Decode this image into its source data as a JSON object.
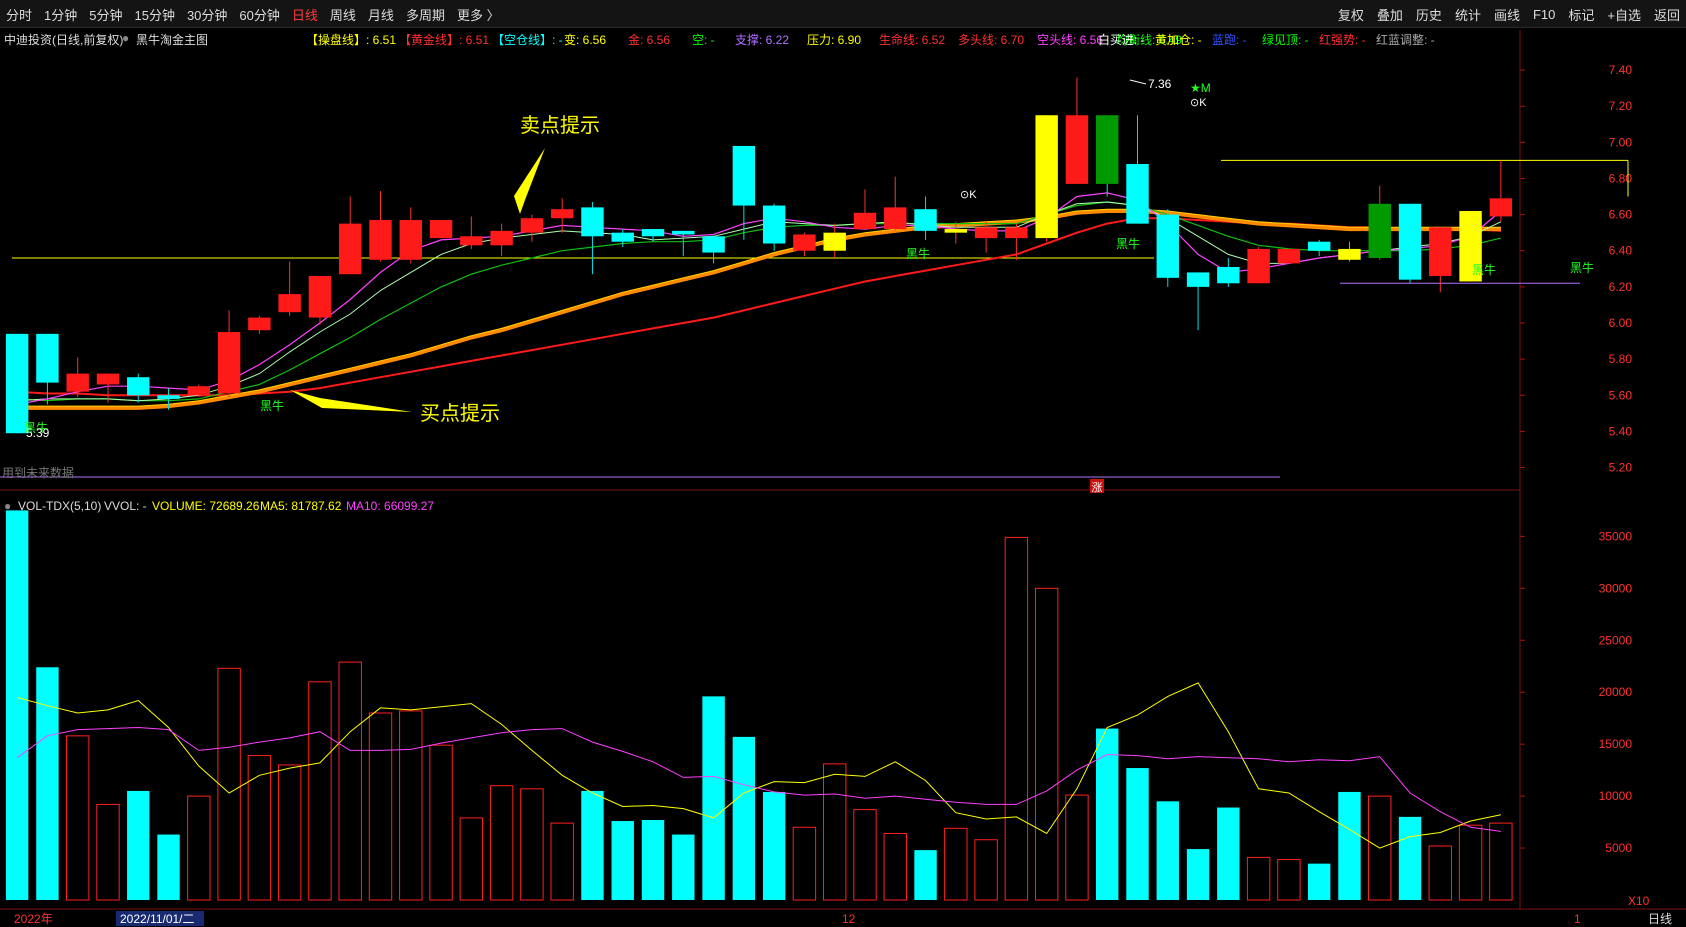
{
  "toolbar": {
    "periods": [
      "分时",
      "1分钟",
      "5分钟",
      "15分钟",
      "30分钟",
      "60分钟",
      "日线",
      "周线",
      "月线",
      "多周期",
      "更多 〉"
    ],
    "active_period": "日线",
    "right": [
      "复权",
      "叠加",
      "历史",
      "统计",
      "画线",
      "F10",
      "标记",
      "+自选",
      "返回"
    ]
  },
  "header": {
    "stock": "中迪投资(日线,前复权)",
    "formula": "黑牛淘金主图",
    "items": [
      {
        "text": "【操盘线】: 6.51",
        "color": "#ffff00"
      },
      {
        "text": "【黄金线】: 6.51",
        "color": "#ff3030"
      },
      {
        "text": "【空仓线】: -",
        "color": "#00ffff"
      },
      {
        "text": "变: 6.56",
        "color": "#ffff00"
      },
      {
        "text": "金: 6.56",
        "color": "#ff3030"
      },
      {
        "text": "空: -",
        "color": "#00ff00"
      },
      {
        "text": "支撑: 6.22",
        "color": "#b070ff"
      },
      {
        "text": "压力: 6.90",
        "color": "#ffff00"
      },
      {
        "text": "生命线: 6.52",
        "color": "#ff3030"
      },
      {
        "text": "多头线: 6.70",
        "color": "#ff3030"
      },
      {
        "text": "空头线: 6.56",
        "color": "#ff40ff"
      },
      {
        "text": "均衡线: 6.49",
        "color": "#00ff00"
      },
      {
        "text": "白买进: -",
        "color": "#ffffff"
      },
      {
        "text": "黄加仓: -",
        "color": "#ffff00"
      },
      {
        "text": "蓝跑: -",
        "color": "#3050ff"
      },
      {
        "text": "绿见顶: -",
        "color": "#00ff00"
      },
      {
        "text": "红强势: -",
        "color": "#ff3030"
      },
      {
        "text": "红蓝调整: -",
        "color": "#aaaaaa"
      }
    ]
  },
  "annotations": {
    "sell": "卖点提示",
    "buy": "买点提示",
    "high": "7.36",
    "low": "5.39",
    "heiniu": "黑牛",
    "star_m": "★M",
    "ok": "⊙K",
    "no_future": "用到未来数据",
    "zhang": "涨"
  },
  "volume_header": {
    "name": "VOL-TDX(5,10)",
    "vvol": "VVOL: -",
    "volume": "VOLUME: 72689.26",
    "ma5": "MA5: 81787.62",
    "ma10": "MA10: 66099.27"
  },
  "axis_bottom": {
    "labels": [
      "2022年",
      "2022/11/01/二",
      "12",
      "1"
    ],
    "right": "日线",
    "x10": "X10"
  },
  "colors": {
    "up": "#ff2020",
    "down": "#00ffff",
    "yellow": "#ffff00",
    "green": "#00c000",
    "magenta": "#ff40ff",
    "bg": "#000000"
  },
  "chart_data": [
    {
      "type": "candlestick",
      "title": "中迪投资(日线,前复权)",
      "ylim": [
        5.12,
        7.5
      ],
      "y_ticks": [
        5.2,
        5.4,
        5.6,
        5.8,
        6.0,
        6.2,
        6.4,
        6.6,
        6.8,
        7.0,
        7.2,
        7.4
      ],
      "candles": [
        {
          "o": 5.94,
          "c": 5.39,
          "h": 5.94,
          "l": 5.39
        },
        {
          "o": 5.94,
          "c": 5.67,
          "h": 5.94,
          "l": 5.55
        },
        {
          "o": 5.62,
          "c": 5.72,
          "h": 5.81,
          "l": 5.59
        },
        {
          "o": 5.66,
          "c": 5.72,
          "h": 5.72,
          "l": 5.56
        },
        {
          "o": 5.7,
          "c": 5.6,
          "h": 5.72,
          "l": 5.56
        },
        {
          "o": 5.6,
          "c": 5.58,
          "h": 5.64,
          "l": 5.52
        },
        {
          "o": 5.6,
          "c": 5.65,
          "h": 5.66,
          "l": 5.59
        },
        {
          "o": 5.61,
          "c": 5.95,
          "h": 6.07,
          "l": 5.59
        },
        {
          "o": 5.96,
          "c": 6.03,
          "h": 6.04,
          "l": 5.94
        },
        {
          "o": 6.06,
          "c": 6.16,
          "h": 6.34,
          "l": 6.04
        },
        {
          "o": 6.03,
          "c": 6.26,
          "h": 6.26,
          "l": 5.99
        },
        {
          "o": 6.27,
          "c": 6.55,
          "h": 6.7,
          "l": 6.27
        },
        {
          "o": 6.35,
          "c": 6.57,
          "h": 6.73,
          "l": 6.34
        },
        {
          "o": 6.35,
          "c": 6.57,
          "h": 6.64,
          "l": 6.33
        },
        {
          "o": 6.47,
          "c": 6.57,
          "h": 6.57,
          "l": 6.47
        },
        {
          "o": 6.43,
          "c": 6.48,
          "h": 6.59,
          "l": 6.41
        },
        {
          "o": 6.43,
          "c": 6.51,
          "h": 6.55,
          "l": 6.37
        },
        {
          "o": 6.5,
          "c": 6.58,
          "h": 6.6,
          "l": 6.45
        },
        {
          "o": 6.58,
          "c": 6.63,
          "h": 6.69,
          "l": 6.5
        },
        {
          "o": 6.64,
          "c": 6.48,
          "h": 6.67,
          "l": 6.27
        },
        {
          "o": 6.5,
          "c": 6.45,
          "h": 6.52,
          "l": 6.42
        },
        {
          "o": 6.52,
          "c": 6.48,
          "h": 6.52,
          "l": 6.45
        },
        {
          "o": 6.51,
          "c": 6.49,
          "h": 6.51,
          "l": 6.37
        },
        {
          "o": 6.48,
          "c": 6.39,
          "h": 6.48,
          "l": 6.33
        },
        {
          "o": 6.98,
          "c": 6.65,
          "h": 6.98,
          "l": 6.46
        },
        {
          "o": 6.65,
          "c": 6.44,
          "h": 6.66,
          "l": 6.4
        },
        {
          "o": 6.4,
          "c": 6.49,
          "h": 6.5,
          "l": 6.37
        },
        {
          "o": 6.4,
          "c": 6.5,
          "h": 6.55,
          "l": 6.36
        },
        {
          "o": 6.52,
          "c": 6.61,
          "h": 6.74,
          "l": 6.52
        },
        {
          "o": 6.52,
          "c": 6.64,
          "h": 6.81,
          "l": 6.51
        },
        {
          "o": 6.63,
          "c": 6.51,
          "h": 6.7,
          "l": 6.46
        },
        {
          "o": 6.5,
          "c": 6.52,
          "h": 6.56,
          "l": 6.44
        },
        {
          "o": 6.47,
          "c": 6.53,
          "h": 6.56,
          "l": 6.39
        },
        {
          "o": 6.47,
          "c": 6.53,
          "h": 6.55,
          "l": 6.35
        },
        {
          "o": 6.47,
          "c": 7.15,
          "h": 7.15,
          "l": 6.45
        },
        {
          "o": 6.77,
          "c": 7.15,
          "h": 7.36,
          "l": 6.77
        },
        {
          "o": 7.15,
          "c": 6.77,
          "h": 7.15,
          "l": 6.7
        },
        {
          "o": 6.88,
          "c": 6.55,
          "h": 7.15,
          "l": 6.55
        },
        {
          "o": 6.6,
          "c": 6.25,
          "h": 6.63,
          "l": 6.2
        },
        {
          "o": 6.28,
          "c": 6.2,
          "h": 6.28,
          "l": 5.96
        },
        {
          "o": 6.31,
          "c": 6.22,
          "h": 6.36,
          "l": 6.2
        },
        {
          "o": 6.22,
          "c": 6.41,
          "h": 6.42,
          "l": 6.22
        },
        {
          "o": 6.33,
          "c": 6.41,
          "h": 6.41,
          "l": 6.33
        },
        {
          "o": 6.45,
          "c": 6.4,
          "h": 6.46,
          "l": 6.37
        },
        {
          "o": 6.41,
          "c": 6.35,
          "h": 6.45,
          "l": 6.34
        },
        {
          "o": 6.36,
          "c": 6.66,
          "h": 6.76,
          "l": 6.35
        },
        {
          "o": 6.66,
          "c": 6.24,
          "h": 6.66,
          "l": 6.22
        },
        {
          "o": 6.26,
          "c": 6.53,
          "h": 6.53,
          "l": 6.17
        },
        {
          "o": 6.23,
          "c": 6.62,
          "h": 6.62,
          "l": 6.23
        },
        {
          "o": 6.59,
          "c": 6.69,
          "h": 6.9,
          "l": 6.56
        }
      ],
      "lines": {
        "ma_white": [
          5.57,
          5.58,
          5.58,
          5.58,
          5.57,
          5.58,
          5.6,
          5.65,
          5.72,
          5.84,
          5.95,
          6.05,
          6.18,
          6.28,
          6.38,
          6.44,
          6.47,
          6.49,
          6.51,
          6.5,
          6.49,
          6.46,
          6.47,
          6.48,
          6.52,
          6.56,
          6.55,
          6.54,
          6.55,
          6.56,
          6.54,
          6.53,
          6.53,
          6.53,
          6.6,
          6.66,
          6.67,
          6.65,
          6.58,
          6.48,
          6.38,
          6.33,
          6.33,
          6.36,
          6.38,
          6.4,
          6.42,
          6.44,
          6.48,
          6.56
        ],
        "green": [
          5.58,
          5.57,
          5.58,
          5.58,
          5.57,
          5.57,
          5.58,
          5.62,
          5.66,
          5.74,
          5.83,
          5.92,
          6.02,
          6.11,
          6.2,
          6.27,
          6.32,
          6.36,
          6.4,
          6.42,
          6.44,
          6.45,
          6.45,
          6.46,
          6.5,
          6.53,
          6.54,
          6.54,
          6.55,
          6.55,
          6.55,
          6.55,
          6.55,
          6.55,
          6.6,
          6.65,
          6.67,
          6.65,
          6.6,
          6.54,
          6.48,
          6.43,
          6.41,
          6.4,
          6.4,
          6.4,
          6.4,
          6.41,
          6.43,
          6.47
        ],
        "orange": [
          5.53,
          5.53,
          5.53,
          5.53,
          5.53,
          5.54,
          5.56,
          5.59,
          5.62,
          5.66,
          5.7,
          5.74,
          5.78,
          5.82,
          5.87,
          5.92,
          5.96,
          6.01,
          6.06,
          6.11,
          6.16,
          6.2,
          6.24,
          6.28,
          6.33,
          6.38,
          6.42,
          6.46,
          6.49,
          6.51,
          6.53,
          6.54,
          6.55,
          6.56,
          6.58,
          6.61,
          6.62,
          6.62,
          6.61,
          6.59,
          6.57,
          6.55,
          6.54,
          6.53,
          6.52,
          6.52,
          6.52,
          6.52,
          6.52,
          6.52
        ],
        "red": [
          5.62,
          5.61,
          5.61,
          5.6,
          5.6,
          5.6,
          5.6,
          5.6,
          5.61,
          5.62,
          5.64,
          5.67,
          5.7,
          5.73,
          5.76,
          5.79,
          5.82,
          5.85,
          5.88,
          5.91,
          5.94,
          5.97,
          6.0,
          6.03,
          6.07,
          6.11,
          6.15,
          6.19,
          6.23,
          6.26,
          6.29,
          6.32,
          6.35,
          6.38,
          6.44,
          6.5,
          6.55,
          6.58,
          6.58,
          6.57,
          6.56,
          6.55,
          6.55,
          6.54,
          6.53,
          6.53,
          6.52,
          6.52,
          6.52,
          6.51
        ],
        "magenta": [
          5.55,
          5.58,
          5.62,
          5.65,
          5.65,
          5.64,
          5.63,
          5.68,
          5.77,
          5.88,
          6.0,
          6.13,
          6.28,
          6.4,
          6.46,
          6.47,
          6.48,
          6.51,
          6.54,
          6.53,
          6.52,
          6.51,
          6.48,
          6.49,
          6.55,
          6.58,
          6.56,
          6.53,
          6.52,
          6.54,
          6.54,
          6.52,
          6.51,
          6.51,
          6.58,
          6.7,
          6.72,
          6.68,
          6.55,
          6.38,
          6.28,
          6.3,
          6.33,
          6.36,
          6.38,
          6.4,
          6.41,
          6.43,
          6.48,
          6.62
        ],
        "support": 6.22,
        "pressure": 6.9,
        "buy_line": 6.36
      }
    },
    {
      "type": "bar",
      "title": "VOL-TDX(5,10)",
      "ylim": [
        0,
        38500
      ],
      "y_ticks": [
        5000,
        10000,
        15000,
        20000,
        25000,
        30000,
        35000
      ],
      "volumes": [
        37500,
        22400,
        15800,
        9200,
        10500,
        6300,
        10000,
        22300,
        13900,
        13000,
        21000,
        22900,
        18000,
        18200,
        14900,
        7900,
        11000,
        10700,
        7400,
        10500,
        7600,
        7700,
        6300,
        19600,
        15700,
        10400,
        7000,
        13100,
        8700,
        6400,
        4800,
        6900,
        5800,
        34900,
        30000,
        10100,
        16500,
        12700,
        9500,
        4900,
        8900,
        4100,
        3900,
        3500,
        10400,
        10000,
        8000,
        5200,
        7200,
        7400
      ],
      "ma5": [
        19500,
        18700,
        18000,
        18300,
        19200,
        16600,
        12900,
        10300,
        12000,
        12700,
        13200,
        16200,
        18500,
        18300,
        18600,
        18900,
        16900,
        14400,
        12000,
        10300,
        9000,
        9100,
        8800,
        7900,
        10300,
        11400,
        11300,
        12100,
        11900,
        13300,
        11500,
        8400,
        7800,
        8000,
        6400,
        10700,
        16600,
        17800,
        19600,
        20900,
        16200,
        10700,
        10300,
        8500,
        6800,
        5000,
        6100,
        6500,
        7600,
        8200
      ],
      "ma10": [
        13700,
        15800,
        16400,
        16500,
        16600,
        16400,
        14400,
        14700,
        15200,
        15600,
        16200,
        14400,
        14400,
        14500,
        15100,
        15600,
        16100,
        16400,
        16500,
        15200,
        14300,
        13300,
        11800,
        11900,
        11100,
        10400,
        10100,
        10200,
        9800,
        10000,
        9700,
        9400,
        9200,
        9200,
        10500,
        12500,
        14000,
        13900,
        13600,
        13800,
        13700,
        13600,
        13300,
        13500,
        13400,
        13800,
        10300,
        8500,
        7000,
        6600
      ]
    }
  ]
}
